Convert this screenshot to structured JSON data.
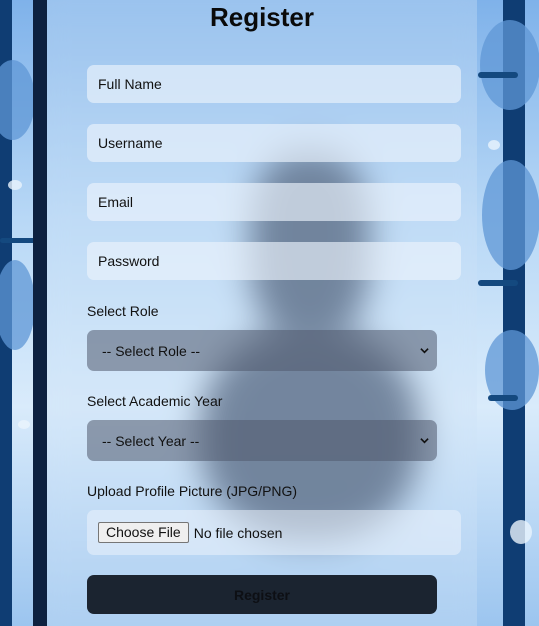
{
  "form": {
    "title": "Register",
    "full_name_placeholder": "Full Name",
    "username_placeholder": "Username",
    "email_placeholder": "Email",
    "password_placeholder": "Password",
    "role_label": "Select Role",
    "role_selected": "-- Select Role --",
    "year_label": "Select Academic Year",
    "year_selected": "-- Select Year --",
    "picture_label": "Upload Profile Picture (JPG/PNG)",
    "file_button": "Choose File",
    "file_status": "No file chosen",
    "submit_label": "Register"
  }
}
